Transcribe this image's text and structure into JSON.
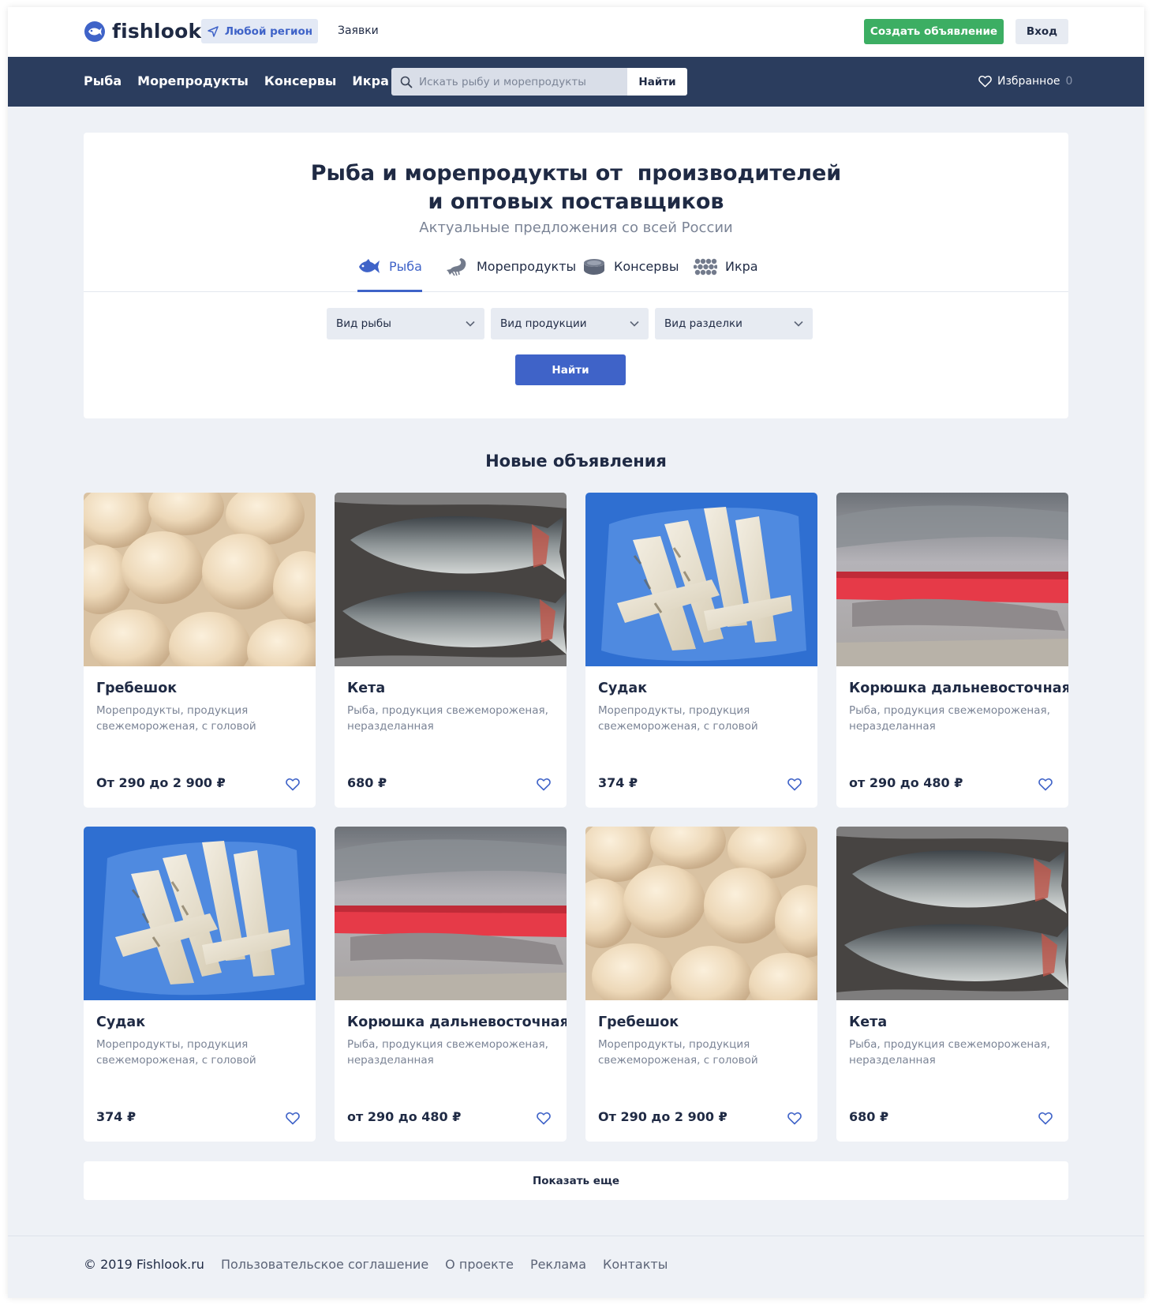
{
  "brand": {
    "name": "fishlook"
  },
  "header": {
    "region_label": "Любой регион",
    "requests_label": "Заявки",
    "create_label": "Создать объявление",
    "login_label": "Вход"
  },
  "nav": {
    "links": [
      "Рыба",
      "Морепродукты",
      "Консервы",
      "Икра"
    ],
    "search_placeholder": "Искать рыбу и морепродукты",
    "search_button": "Найти",
    "favorites_label": "Избранное",
    "favorites_count": "0"
  },
  "hero": {
    "title_line1": "Рыба и морепродукты от  производителей",
    "title_line2": "и оптовых поставщиков",
    "subtitle": "Актуальные предложения со всей России",
    "tabs": [
      {
        "label": "Рыба",
        "icon": "fish-icon",
        "active": true
      },
      {
        "label": "Морепродукты",
        "icon": "shrimp-icon",
        "active": false
      },
      {
        "label": "Консервы",
        "icon": "can-icon",
        "active": false
      },
      {
        "label": "Икра",
        "icon": "caviar-icon",
        "active": false
      }
    ],
    "filters": [
      "Вид рыбы",
      "Вид продукции",
      "Вид разделки"
    ],
    "find_button": "Найти"
  },
  "listings": {
    "title": "Новые объявления",
    "items": [
      {
        "title": "Гребешок",
        "desc": "Морепродукты, продукция свежемороженая, с головой",
        "price": "От 290 до 2 900 ₽",
        "photo": "scallops"
      },
      {
        "title": "Кета",
        "desc": "Рыба, продукция свежемороженая, неразделанная",
        "price": "680 ₽",
        "photo": "chum-salmon"
      },
      {
        "title": "Судак",
        "desc": "Морепродукты, продукция свежемороженая, с головой",
        "price": "374 ₽",
        "photo": "zander"
      },
      {
        "title": "Корюшка дальневосточная",
        "desc": "Рыба, продукция свежемороженая, неразделанная",
        "price": "от 290 до 480 ₽",
        "photo": "smelt"
      },
      {
        "title": "Судак",
        "desc": "Морепродукты, продукция свежемороженая, с головой",
        "price": "374 ₽",
        "photo": "zander"
      },
      {
        "title": "Корюшка дальневосточная",
        "desc": "Рыба, продукция свежемороженая, неразделанная",
        "price": "от 290 до 480 ₽",
        "photo": "smelt"
      },
      {
        "title": "Гребешок",
        "desc": "Морепродукты, продукция свежемороженая, с головой",
        "price": "От 290 до 2 900 ₽",
        "photo": "scallops"
      },
      {
        "title": "Кета",
        "desc": "Рыба, продукция свежемороженая, неразделанная",
        "price": "680 ₽",
        "photo": "chum-salmon"
      }
    ],
    "more_button": "Показать еще"
  },
  "footer": {
    "links": [
      "© 2019 Fishlook.ru",
      "Пользовательское соглашение",
      "О проекте",
      "Реклама",
      "Контакты"
    ]
  },
  "colors": {
    "brand_blue": "#3f63c8",
    "nav_dark": "#2b3d5e",
    "create_green": "#3cae63",
    "page_bg": "#eef1f6"
  }
}
